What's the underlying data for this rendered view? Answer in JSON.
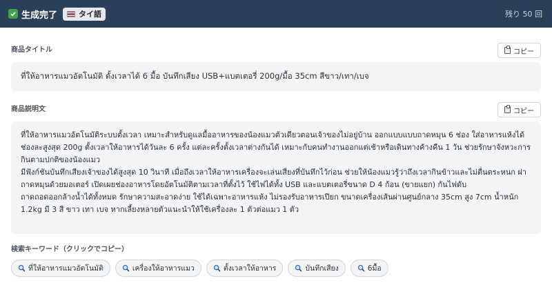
{
  "header": {
    "status_label": "生成完了",
    "language_label": "タイ語",
    "remaining": "残り 50 回",
    "colors": {
      "background": "#2b3f58",
      "check": "#3fa34d"
    },
    "icons": {
      "status": "check-icon",
      "language": "thai-flag-icon"
    }
  },
  "title_section": {
    "label": "商品タイトル",
    "copy_label": "コピー",
    "text": "ที่ให้อาหารแมวอัตโนมัติ ตั้งเวลาได้ 6 มื้อ บันทึกเสียง USB+แบตเตอรี่ 200g/มื้อ 35cm สีขาว/เทา/เบจ"
  },
  "description_section": {
    "label": "商品説明文",
    "copy_label": "コピー",
    "paragraphs": [
      "ที่ให้อาหารแมวอัตโนมัติระบบตั้งเวลา เหมาะสำหรับดูแลมื้ออาหารของน้องแมวตัวเดียวตอนเจ้าของไม่อยู่บ้าน ออกแบบแบบถาดหมุน 6 ช่อง ใส่อาหารแห้งได้ช่องละสูงสุด 200g ตั้งเวลาให้อาหารได้วันละ 6 ครั้ง แต่ละครั้งตั้งเวลาต่างกันได้ เหมาะกับคนทำงานออกแต่เช้าหรือเดินทางค้างคืน 1 วัน ช่วยรักษาจังหวะการกินตามปกติของน้องแมว",
      "มีฟังก์ชันบันทึกเสียงเจ้าของได้สูงสุด 10 วินาที เมื่อถึงเวลาให้อาหารเครื่องจะเล่นเสียงที่บันทึกไว้ก่อน ช่วยให้น้องแมวรู้ว่าถึงเวลากินข้าวและไม่ตื่นตระหนก ฝาถาดหมุนด้วยมอเตอร์ เปิดเผยช่องอาหารโดยอัตโนมัติตามเวลาที่ตั้งไว้ ใช้ไฟได้ทั้ง USB และแบตเตอรี่ขนาด D 4 ก้อน (ขายแยก) กันไฟดับ",
      "ถาดถอดออกล้างน้ำได้ทั้งหมด รักษาความสะอาดง่าย ใช้ได้เฉพาะอาหารแห้ง ไม่รองรับอาหารเปียก ขนาดเครื่องเส้นผ่านศูนย์กลาง 35cm สูง 7cm น้ำหนัก 1.2kg มี 3 สี ขาว เทา เบจ หากเลี้ยงหลายตัวแนะนำให้ใช้เครื่องละ 1 ตัวต่อแมว 1 ตัว"
    ]
  },
  "keywords_section": {
    "label": "検索キーワード（クリックでコピー）",
    "items": [
      "ที่ให้อาหารแมวอัตโนมัติ",
      "เครื่องให้อาหารแมว",
      "ตั้งเวลาให้อาหาร",
      "บันทึกเสียง",
      "6มื้อ"
    ]
  }
}
